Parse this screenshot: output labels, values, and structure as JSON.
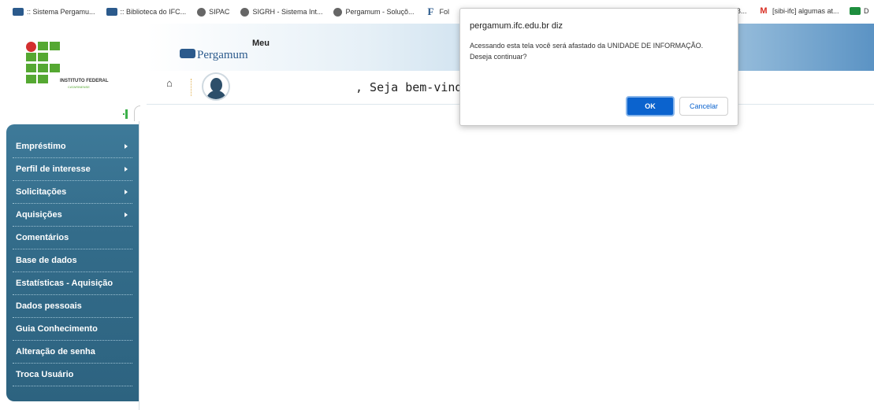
{
  "bookmarks": [
    {
      "label": ":: Sistema Pergamu...",
      "icon": "pergamum-icon"
    },
    {
      "label": ":: Biblioteca do IFC...",
      "icon": "pergamum-icon"
    },
    {
      "label": "SIPAC",
      "icon": "globe-icon"
    },
    {
      "label": "SIGRH - Sistema Int...",
      "icon": "globe-icon"
    },
    {
      "label": "Pergamum - Soluçõ...",
      "icon": "globe-icon"
    },
    {
      "label": "Fol",
      "icon": "f-icon"
    }
  ],
  "bookmarks_right": [
    {
      "label": "B...",
      "icon": ""
    },
    {
      "label": "[sibi-ifc] algumas at...",
      "icon": "gmail-icon"
    },
    {
      "label": "D",
      "icon": "d-icon"
    }
  ],
  "logo": {
    "name": "INSTITUTO FEDERAL",
    "sub": "CATARINENSE"
  },
  "pergamum": {
    "meu": "Meu",
    "name": "Pergamum"
  },
  "welcome": ", Seja bem-vindo(a)!",
  "sidebar": {
    "items": [
      {
        "label": "Empréstimo",
        "has_arrow": true
      },
      {
        "label": "Perfil de interesse",
        "has_arrow": true
      },
      {
        "label": "Solicitações",
        "has_arrow": true
      },
      {
        "label": "Aquisições",
        "has_arrow": true
      },
      {
        "label": "Comentários",
        "has_arrow": false
      },
      {
        "label": "Base de dados",
        "has_arrow": false
      },
      {
        "label": "Estatísticas - Aquisição",
        "has_arrow": false
      },
      {
        "label": "Dados pessoais",
        "has_arrow": false
      },
      {
        "label": "Guia Conhecimento",
        "has_arrow": false
      },
      {
        "label": "Alteração de senha",
        "has_arrow": false
      },
      {
        "label": "Troca Usuário",
        "has_arrow": false
      }
    ]
  },
  "dialog": {
    "title": "pergamum.ifc.edu.br diz",
    "message_line1": "Acessando esta tela você será afastado da UNIDADE DE INFORMAÇÃO.",
    "message_line2": "Deseja continuar?",
    "ok_label": "OK",
    "cancel_label": "Cancelar"
  },
  "colors": {
    "sidebar": "#336c8a",
    "accent_green": "#55a832",
    "dialog_button": "#0b63ce"
  }
}
